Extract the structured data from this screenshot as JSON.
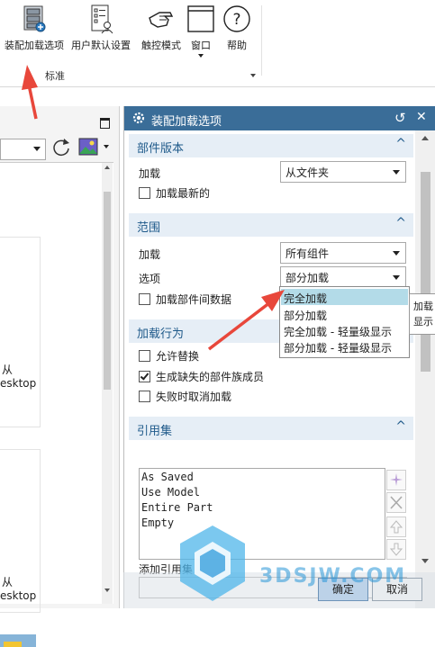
{
  "ribbon": {
    "buttons": [
      {
        "label": "装配加载选项"
      },
      {
        "label": "用户默认设置"
      },
      {
        "label": "触控模式"
      },
      {
        "label": "窗口"
      },
      {
        "label": "帮助"
      }
    ],
    "group_label": "标准"
  },
  "left_window": {
    "labels": [
      "从",
      "esktop",
      "从",
      "esktop"
    ]
  },
  "dialog": {
    "title": "装配加载选项",
    "sections": {
      "part_version": {
        "title": "部件版本",
        "load_label": "加载",
        "load_value": "从文件夹",
        "load_latest": "加载最新的"
      },
      "scope": {
        "title": "范围",
        "load_label": "加载",
        "load_value": "所有组件",
        "option_label": "选项",
        "option_value": "部分加载",
        "load_inter_part": "加载部件间数据"
      },
      "load_behavior": {
        "title": "加载行为",
        "allow_replace": "允许替换",
        "generate_missing": "生成缺失的部件族成员",
        "cancel_on_fail": "失败时取消加载"
      },
      "reference_sets": {
        "title": "引用集",
        "items": [
          "As Saved",
          "Use Model",
          "Entire Part",
          "Empty"
        ],
        "add_label": "添加引用集"
      }
    },
    "dropdown_options": [
      "完全加载",
      "部分加载",
      "完全加载 - 轻量级显示",
      "部分加载 - 轻量级显示"
    ],
    "tooltip_lines": [
      "加载",
      "显示"
    ],
    "ok_label": "确定",
    "cancel_label": "取消"
  },
  "watermark": "3DSJW.COM",
  "colors": {
    "title_bar": "#3a6d98",
    "section_header": "#e6eef6",
    "selected_option": "#b3dbe8",
    "arrow": "#e8473b"
  }
}
